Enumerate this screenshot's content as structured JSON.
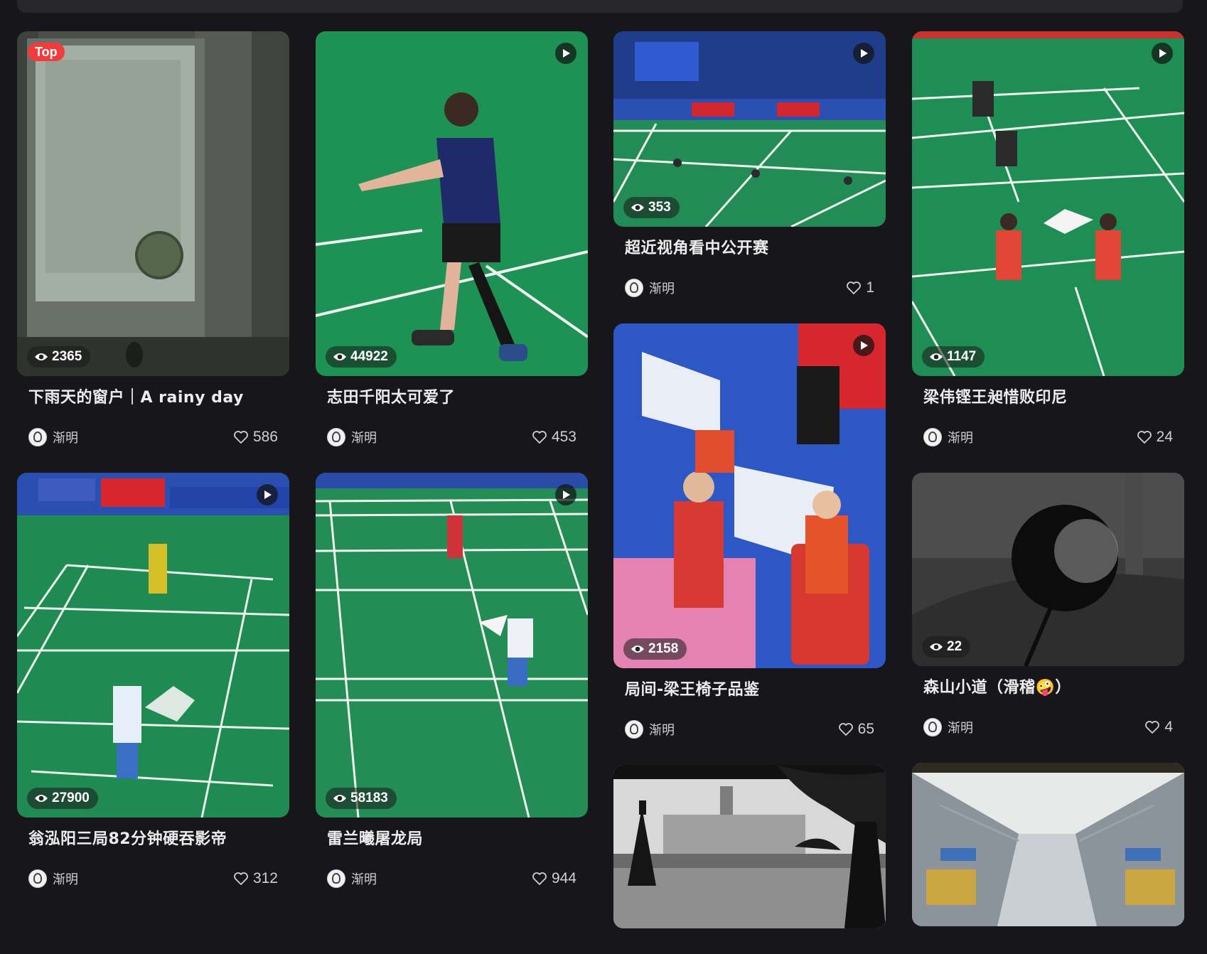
{
  "columns": [
    [
      {
        "title": "下雨天的窗户｜A rainy day",
        "views": "2365",
        "author": "渐明",
        "likes": "586",
        "top": true,
        "video": false,
        "scene": "window"
      },
      {
        "title": "翁泓阳三局82分钟硬吞影帝",
        "views": "27900",
        "author": "渐明",
        "likes": "312",
        "top": false,
        "video": true,
        "scene": "court-blue"
      }
    ],
    [
      {
        "title": "志田千阳太可爱了",
        "views": "44922",
        "author": "渐明",
        "likes": "453",
        "top": false,
        "video": true,
        "scene": "player"
      },
      {
        "title": "雷兰曦屠龙局",
        "views": "58183",
        "author": "渐明",
        "likes": "944",
        "top": false,
        "video": true,
        "scene": "court"
      }
    ],
    [
      {
        "title": "超近视角看中公开赛",
        "views": "353",
        "author": "渐明",
        "likes": "1",
        "top": false,
        "video": true,
        "scene": "arena"
      },
      {
        "title": "局间-梁王椅子品鉴",
        "views": "2158",
        "author": "渐明",
        "likes": "65",
        "top": false,
        "video": true,
        "scene": "bench"
      },
      {
        "title": "",
        "views": "",
        "author": "",
        "likes": "",
        "top": false,
        "video": false,
        "scene": "city-bw"
      }
    ],
    [
      {
        "title": "梁伟铿王昶惜败印尼",
        "views": "1147",
        "author": "渐明",
        "likes": "24",
        "top": false,
        "video": true,
        "scene": "court-doubles"
      },
      {
        "title": "森山小道（滑稽🤪）",
        "views": "22",
        "author": "渐明",
        "likes": "4",
        "top": false,
        "video": false,
        "scene": "mirror-bw"
      },
      {
        "title": "",
        "views": "",
        "author": "",
        "likes": "",
        "top": false,
        "video": false,
        "scene": "subway"
      }
    ]
  ],
  "labels": {
    "top_badge": "Top"
  }
}
